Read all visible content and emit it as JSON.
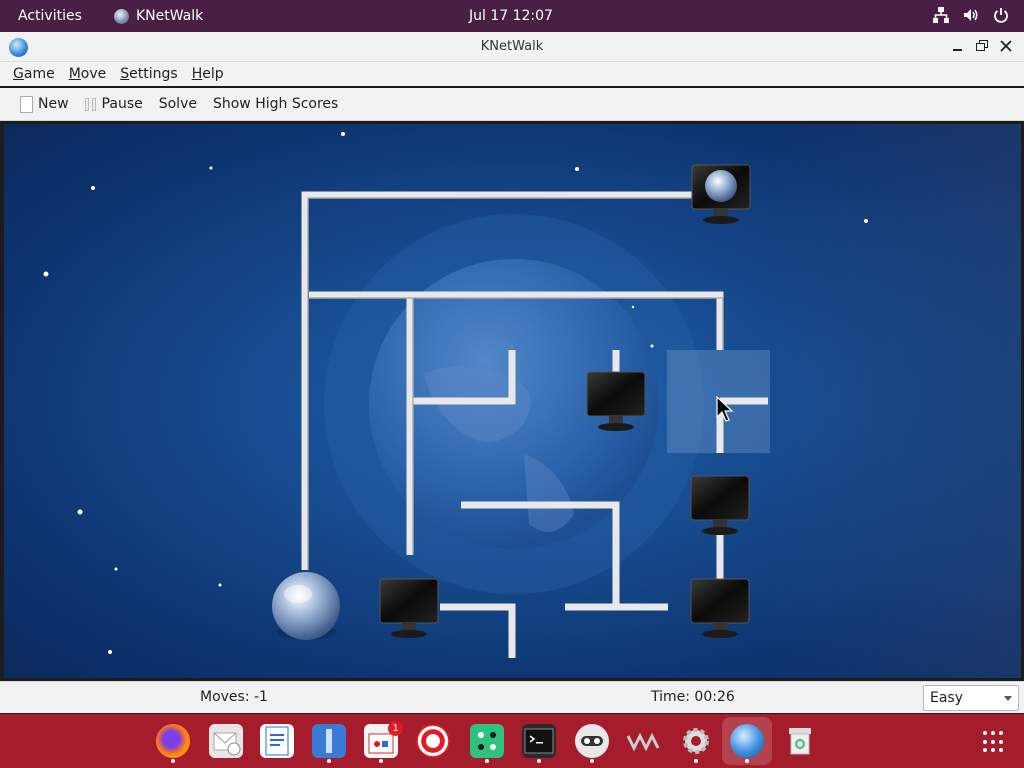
{
  "topbar": {
    "activities": "Activities",
    "app_name": "KNetWalk",
    "clock": "Jul 17  12:07",
    "icons": [
      "network-icon",
      "volume-icon",
      "power-icon"
    ]
  },
  "window": {
    "title": "KNetWalk",
    "controls": [
      "minimize-icon",
      "maximize-icon",
      "close-icon"
    ]
  },
  "menu": {
    "items": [
      {
        "first": "G",
        "rest": "ame"
      },
      {
        "first": "M",
        "rest": "ove"
      },
      {
        "first": "S",
        "rest": "ettings"
      },
      {
        "first": "H",
        "rest": "elp"
      }
    ]
  },
  "toolbar": {
    "new_label": "New",
    "pause_label": "Pause",
    "solve_label": "Solve",
    "highscores_label": "Show High Scores"
  },
  "status": {
    "moves": "Moves: -1",
    "time": "Time: 00:26",
    "difficulty": "Easy"
  },
  "colors": {
    "topbar": "#4a1f45",
    "dock": "#a51d2d",
    "board": "#164a8d"
  },
  "dock": {
    "apps": [
      "firefox-icon",
      "evolution-icon",
      "writer-icon",
      "files-icon",
      "software-icon",
      "help-icon",
      "games-icon",
      "terminal-icon",
      "robot-icon",
      "vm-icon",
      "settings-icon",
      "knetwalk-icon",
      "trash-icon"
    ],
    "software_badge": "1"
  }
}
